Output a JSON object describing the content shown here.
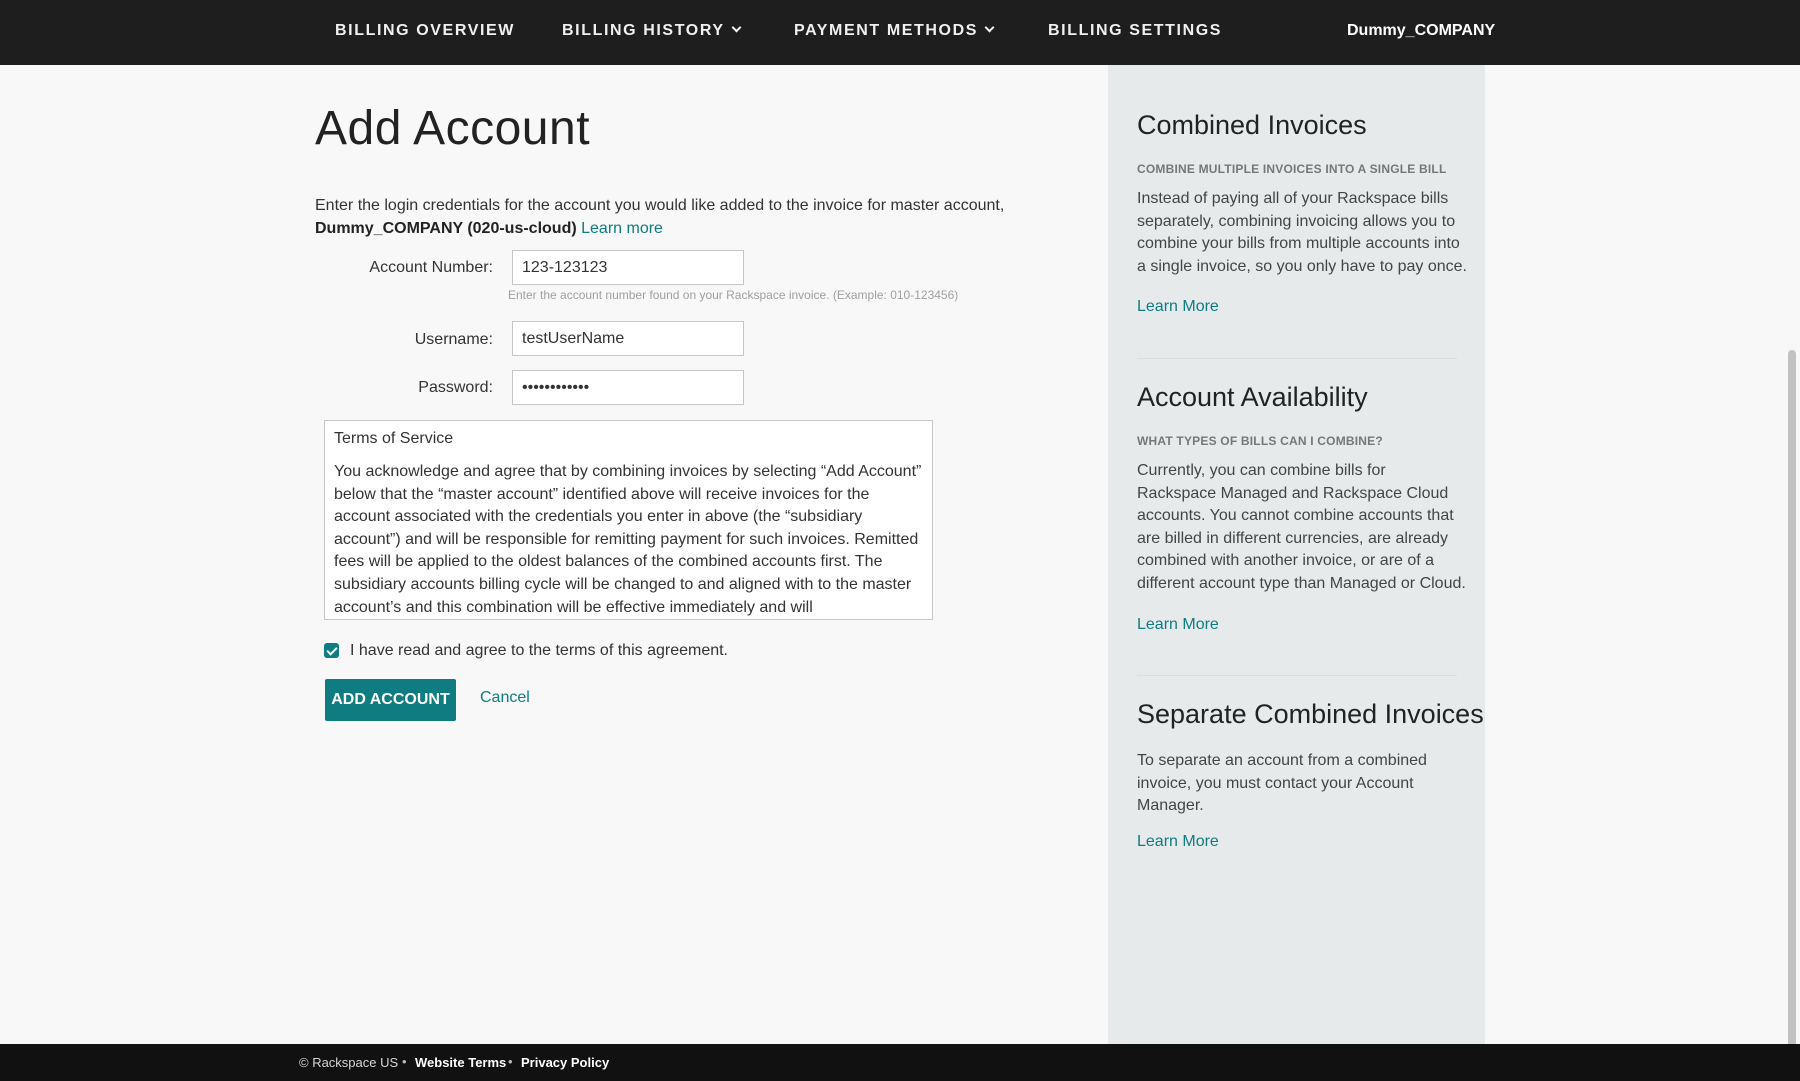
{
  "nav": {
    "items": [
      {
        "label": "BILLING OVERVIEW",
        "dropdown": false
      },
      {
        "label": "BILLING HISTORY",
        "dropdown": true
      },
      {
        "label": "PAYMENT METHODS",
        "dropdown": true
      },
      {
        "label": "BILLING SETTINGS",
        "dropdown": false
      }
    ],
    "company": "Dummy_COMPANY"
  },
  "main": {
    "title": "Add Account",
    "intro_text": "Enter the login credentials for the account you would like added to the invoice for master account,",
    "intro_account": "Dummy_COMPANY (020-us-cloud)",
    "intro_link": "Learn more",
    "account_number": {
      "label": "Account Number:",
      "value": "123-123123",
      "hint": "Enter the account number found on your Rackspace invoice. (Example: 010-123456)"
    },
    "username": {
      "label": "Username:",
      "value": "testUserName"
    },
    "password": {
      "label": "Password:",
      "value": "••••••••••••"
    },
    "tos": {
      "title": "Terms of Service",
      "body": "You acknowledge and agree that by combining invoices by selecting “Add Account” below that the “master account” identified above will receive invoices for the account associated with the credentials you enter in above (the “subsidiary account”) and will be responsible for remitting payment for such invoices. Remitted fees will be applied to the oldest balances of the combined accounts first. The subsidiary accounts billing cycle will be changed to and aligned with to the master account’s and this combination will be effective immediately and will"
    },
    "agree_label": "I have read and agree to the terms of this agreement.",
    "agree_checked": true,
    "add_button": "ADD ACCOUNT",
    "cancel": "Cancel"
  },
  "sidebar": {
    "sections": [
      {
        "title": "Combined Invoices",
        "subtitle": "COMBINE MULTIPLE INVOICES INTO A SINGLE BILL",
        "body": "Instead of paying all of your Rackspace bills separately, combining invoicing allows you to combine your bills from multiple accounts into a single invoice, so you only have to pay once.",
        "link": "Learn More"
      },
      {
        "title": "Account Availability",
        "subtitle": "WHAT TYPES OF BILLS CAN I COMBINE?",
        "body": "Currently, you can combine bills for Rackspace Managed and Rackspace Cloud accounts. You cannot combine accounts that are billed in different currencies, are already combined with another invoice, or are of a different account type than Managed or Cloud.",
        "link": "Learn More"
      },
      {
        "title": "Separate Combined Invoices",
        "body": "To separate an account from a combined invoice, you must contact your Account Manager.",
        "link": "Learn More"
      }
    ]
  },
  "footer": {
    "copyright": "© Rackspace US",
    "website_terms": "Website Terms",
    "privacy_policy": "Privacy Policy",
    "separator": "•"
  },
  "colors": {
    "accent": "#0e7c80",
    "nav_bg": "#1e1e1e",
    "sidebar_bg": "#e7eaeb",
    "footer_bg": "#111111"
  }
}
